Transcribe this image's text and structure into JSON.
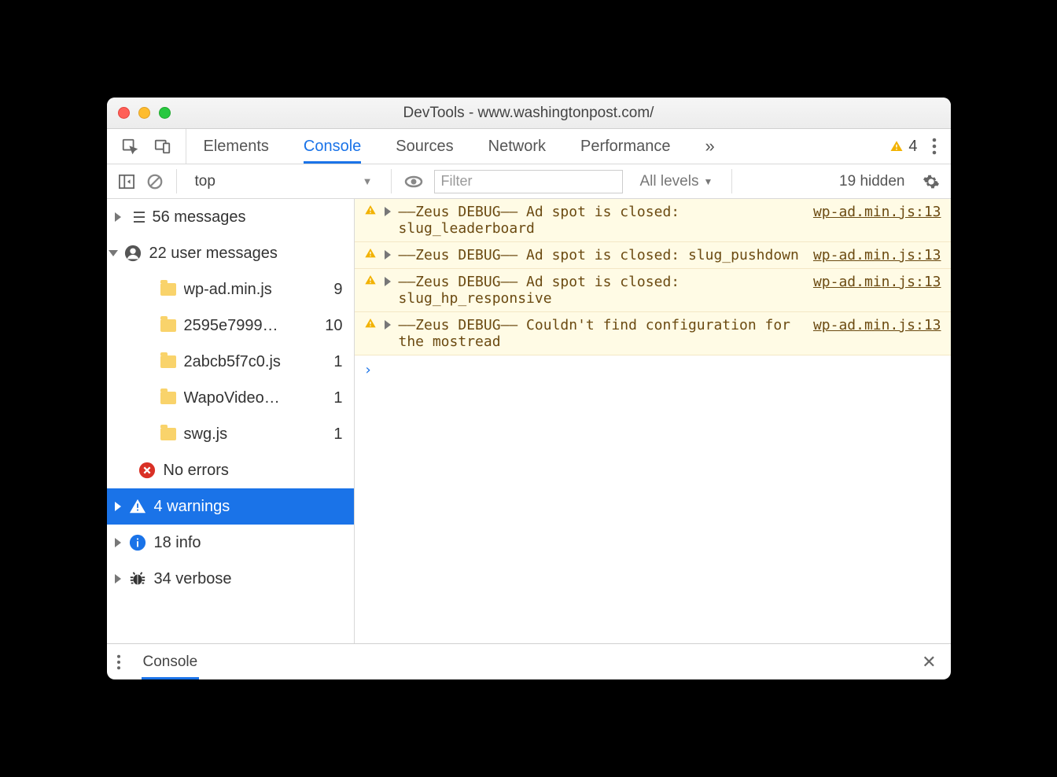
{
  "window": {
    "title": "DevTools - www.washingtonpost.com/"
  },
  "tabs": {
    "items": [
      "Elements",
      "Console",
      "Sources",
      "Network",
      "Performance"
    ],
    "active_index": 1,
    "overflow_glyph": "»",
    "warn_count": "4"
  },
  "filterbar": {
    "context": "top",
    "filter_placeholder": "Filter",
    "levels_label": "All levels",
    "hidden_label": "19 hidden"
  },
  "sidebar": {
    "messages": {
      "label": "56 messages"
    },
    "user_messages": {
      "label": "22 user messages"
    },
    "files": [
      {
        "name": "wp-ad.min.js",
        "count": "9"
      },
      {
        "name": "2595e7999…",
        "count": "10"
      },
      {
        "name": "2abcb5f7c0.js",
        "count": "1"
      },
      {
        "name": "WapoVideo…",
        "count": "1"
      },
      {
        "name": "swg.js",
        "count": "1"
      }
    ],
    "errors": {
      "label": "No errors"
    },
    "warnings": {
      "label": "4 warnings"
    },
    "info": {
      "label": "18 info"
    },
    "verbose": {
      "label": "34 verbose"
    }
  },
  "messages": [
    {
      "text": "––Zeus DEBUG–– Ad spot is closed: slug_leaderboard",
      "src": "wp-ad.min.js:13"
    },
    {
      "text": "––Zeus DEBUG–– Ad spot is closed: slug_pushdown",
      "src": "wp-ad.min.js:13"
    },
    {
      "text": "––Zeus DEBUG–– Ad spot is closed: slug_hp_responsive",
      "src": "wp-ad.min.js:13"
    },
    {
      "text": "––Zeus DEBUG–– Couldn't find configuration for the mostread",
      "src": "wp-ad.min.js:13"
    }
  ],
  "drawer": {
    "label": "Console"
  },
  "glyphs": {
    "prompt": "›",
    "dropdown": "▼",
    "close": "✕"
  }
}
